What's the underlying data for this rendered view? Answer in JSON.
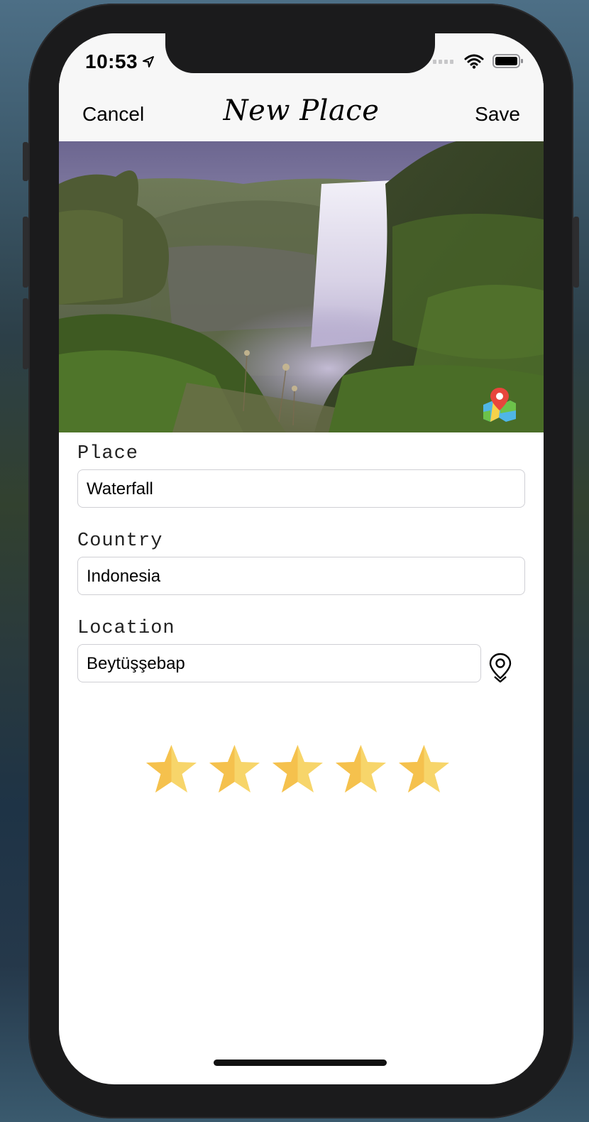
{
  "status_bar": {
    "time": "10:53"
  },
  "nav": {
    "cancel_label": "Cancel",
    "title": "New Place",
    "save_label": "Save"
  },
  "photo": {
    "subject": "waterfall",
    "map_button_icon": "map-pin-icon"
  },
  "form": {
    "place_label": "Place",
    "place_value": "Waterfall",
    "country_label": "Country",
    "country_value": "Indonesia",
    "location_label": "Location",
    "location_value": "Beytüşşebap",
    "location_button_icon": "location-pin-icon"
  },
  "rating": {
    "value": 5,
    "max": 5,
    "star_color": "#f7d56a"
  }
}
